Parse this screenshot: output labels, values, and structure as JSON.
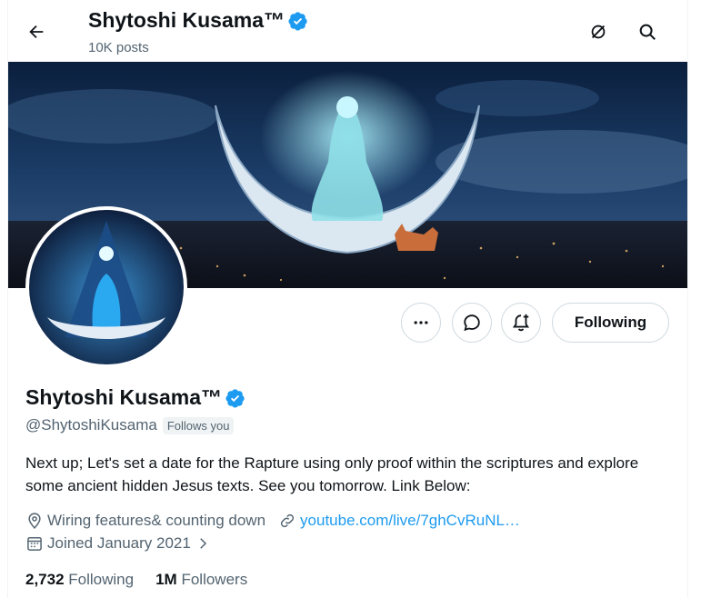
{
  "header": {
    "display_name": "Shytoshi Kusama™",
    "posts_count": "10K posts"
  },
  "profile": {
    "display_name": "Shytoshi Kusama™",
    "handle": "@ShytoshiKusama",
    "follows_you_badge": "Follows you",
    "bio": "Next up; Let's set a date for the Rapture using only proof within the scriptures and explore some ancient hidden Jesus texts. See you tomorrow.  Link Below:",
    "location": "Wiring features& counting down",
    "link": "youtube.com/live/7ghCvRuNL…",
    "joined": "Joined January 2021",
    "following_count": "2,732",
    "following_label": "Following",
    "followers_count": "1M",
    "followers_label": "Followers"
  },
  "actions": {
    "follow_button_label": "Following"
  },
  "colors": {
    "verified": "#1d9bf0",
    "link": "#1d9bf0",
    "secondary_text": "#536471"
  }
}
